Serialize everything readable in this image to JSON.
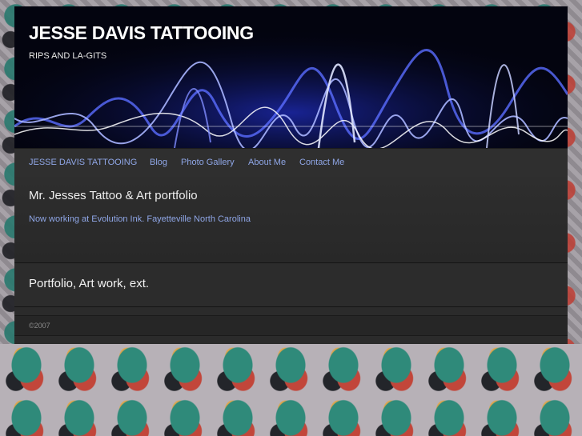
{
  "header": {
    "title": "JESSE DAVIS TATTOOING",
    "tagline": "RIPS AND LA-GITS"
  },
  "nav": {
    "items": [
      {
        "label": "JESSE DAVIS TATTOOING"
      },
      {
        "label": "Blog"
      },
      {
        "label": "Photo Gallery"
      },
      {
        "label": "About Me"
      },
      {
        "label": "Contact Me"
      }
    ]
  },
  "main": {
    "heading": "Mr. Jesses Tattoo & Art portfolio",
    "subtext": "Now working at Evolution Ink. Fayetteville North Carolina",
    "section2_heading": "Portfolio, Art work, ext."
  },
  "footer": {
    "copyright": "©2007"
  },
  "colors": {
    "link": "#8fa6e6",
    "header_bg": "#03040f",
    "panel_bg": "#2b2b2b"
  }
}
